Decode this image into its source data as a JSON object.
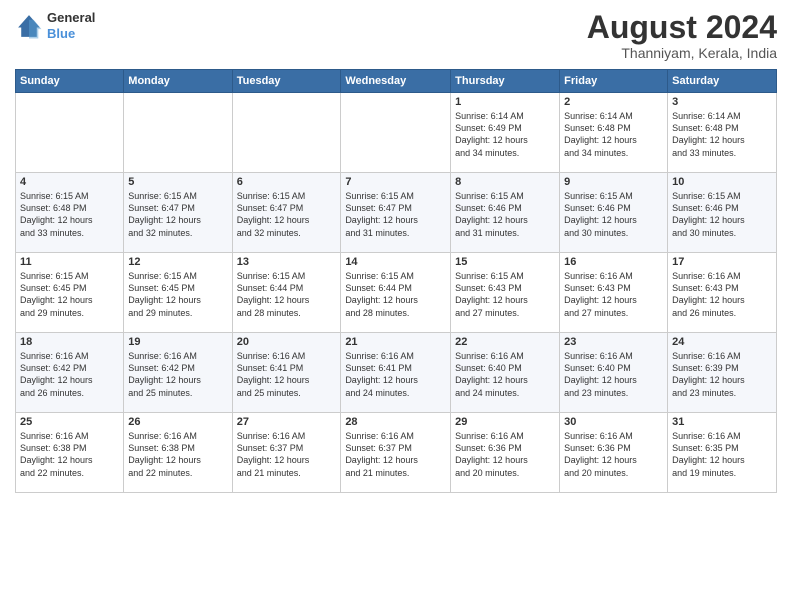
{
  "logo": {
    "general": "General",
    "blue": "Blue"
  },
  "title": "August 2024",
  "location": "Thanniyam, Kerala, India",
  "days_header": [
    "Sunday",
    "Monday",
    "Tuesday",
    "Wednesday",
    "Thursday",
    "Friday",
    "Saturday"
  ],
  "weeks": [
    [
      {
        "num": "",
        "info": ""
      },
      {
        "num": "",
        "info": ""
      },
      {
        "num": "",
        "info": ""
      },
      {
        "num": "",
        "info": ""
      },
      {
        "num": "1",
        "info": "Sunrise: 6:14 AM\nSunset: 6:49 PM\nDaylight: 12 hours\nand 34 minutes."
      },
      {
        "num": "2",
        "info": "Sunrise: 6:14 AM\nSunset: 6:48 PM\nDaylight: 12 hours\nand 34 minutes."
      },
      {
        "num": "3",
        "info": "Sunrise: 6:14 AM\nSunset: 6:48 PM\nDaylight: 12 hours\nand 33 minutes."
      }
    ],
    [
      {
        "num": "4",
        "info": "Sunrise: 6:15 AM\nSunset: 6:48 PM\nDaylight: 12 hours\nand 33 minutes."
      },
      {
        "num": "5",
        "info": "Sunrise: 6:15 AM\nSunset: 6:47 PM\nDaylight: 12 hours\nand 32 minutes."
      },
      {
        "num": "6",
        "info": "Sunrise: 6:15 AM\nSunset: 6:47 PM\nDaylight: 12 hours\nand 32 minutes."
      },
      {
        "num": "7",
        "info": "Sunrise: 6:15 AM\nSunset: 6:47 PM\nDaylight: 12 hours\nand 31 minutes."
      },
      {
        "num": "8",
        "info": "Sunrise: 6:15 AM\nSunset: 6:46 PM\nDaylight: 12 hours\nand 31 minutes."
      },
      {
        "num": "9",
        "info": "Sunrise: 6:15 AM\nSunset: 6:46 PM\nDaylight: 12 hours\nand 30 minutes."
      },
      {
        "num": "10",
        "info": "Sunrise: 6:15 AM\nSunset: 6:46 PM\nDaylight: 12 hours\nand 30 minutes."
      }
    ],
    [
      {
        "num": "11",
        "info": "Sunrise: 6:15 AM\nSunset: 6:45 PM\nDaylight: 12 hours\nand 29 minutes."
      },
      {
        "num": "12",
        "info": "Sunrise: 6:15 AM\nSunset: 6:45 PM\nDaylight: 12 hours\nand 29 minutes."
      },
      {
        "num": "13",
        "info": "Sunrise: 6:15 AM\nSunset: 6:44 PM\nDaylight: 12 hours\nand 28 minutes."
      },
      {
        "num": "14",
        "info": "Sunrise: 6:15 AM\nSunset: 6:44 PM\nDaylight: 12 hours\nand 28 minutes."
      },
      {
        "num": "15",
        "info": "Sunrise: 6:15 AM\nSunset: 6:43 PM\nDaylight: 12 hours\nand 27 minutes."
      },
      {
        "num": "16",
        "info": "Sunrise: 6:16 AM\nSunset: 6:43 PM\nDaylight: 12 hours\nand 27 minutes."
      },
      {
        "num": "17",
        "info": "Sunrise: 6:16 AM\nSunset: 6:43 PM\nDaylight: 12 hours\nand 26 minutes."
      }
    ],
    [
      {
        "num": "18",
        "info": "Sunrise: 6:16 AM\nSunset: 6:42 PM\nDaylight: 12 hours\nand 26 minutes."
      },
      {
        "num": "19",
        "info": "Sunrise: 6:16 AM\nSunset: 6:42 PM\nDaylight: 12 hours\nand 25 minutes."
      },
      {
        "num": "20",
        "info": "Sunrise: 6:16 AM\nSunset: 6:41 PM\nDaylight: 12 hours\nand 25 minutes."
      },
      {
        "num": "21",
        "info": "Sunrise: 6:16 AM\nSunset: 6:41 PM\nDaylight: 12 hours\nand 24 minutes."
      },
      {
        "num": "22",
        "info": "Sunrise: 6:16 AM\nSunset: 6:40 PM\nDaylight: 12 hours\nand 24 minutes."
      },
      {
        "num": "23",
        "info": "Sunrise: 6:16 AM\nSunset: 6:40 PM\nDaylight: 12 hours\nand 23 minutes."
      },
      {
        "num": "24",
        "info": "Sunrise: 6:16 AM\nSunset: 6:39 PM\nDaylight: 12 hours\nand 23 minutes."
      }
    ],
    [
      {
        "num": "25",
        "info": "Sunrise: 6:16 AM\nSunset: 6:38 PM\nDaylight: 12 hours\nand 22 minutes."
      },
      {
        "num": "26",
        "info": "Sunrise: 6:16 AM\nSunset: 6:38 PM\nDaylight: 12 hours\nand 22 minutes."
      },
      {
        "num": "27",
        "info": "Sunrise: 6:16 AM\nSunset: 6:37 PM\nDaylight: 12 hours\nand 21 minutes."
      },
      {
        "num": "28",
        "info": "Sunrise: 6:16 AM\nSunset: 6:37 PM\nDaylight: 12 hours\nand 21 minutes."
      },
      {
        "num": "29",
        "info": "Sunrise: 6:16 AM\nSunset: 6:36 PM\nDaylight: 12 hours\nand 20 minutes."
      },
      {
        "num": "30",
        "info": "Sunrise: 6:16 AM\nSunset: 6:36 PM\nDaylight: 12 hours\nand 20 minutes."
      },
      {
        "num": "31",
        "info": "Sunrise: 6:16 AM\nSunset: 6:35 PM\nDaylight: 12 hours\nand 19 minutes."
      }
    ]
  ]
}
